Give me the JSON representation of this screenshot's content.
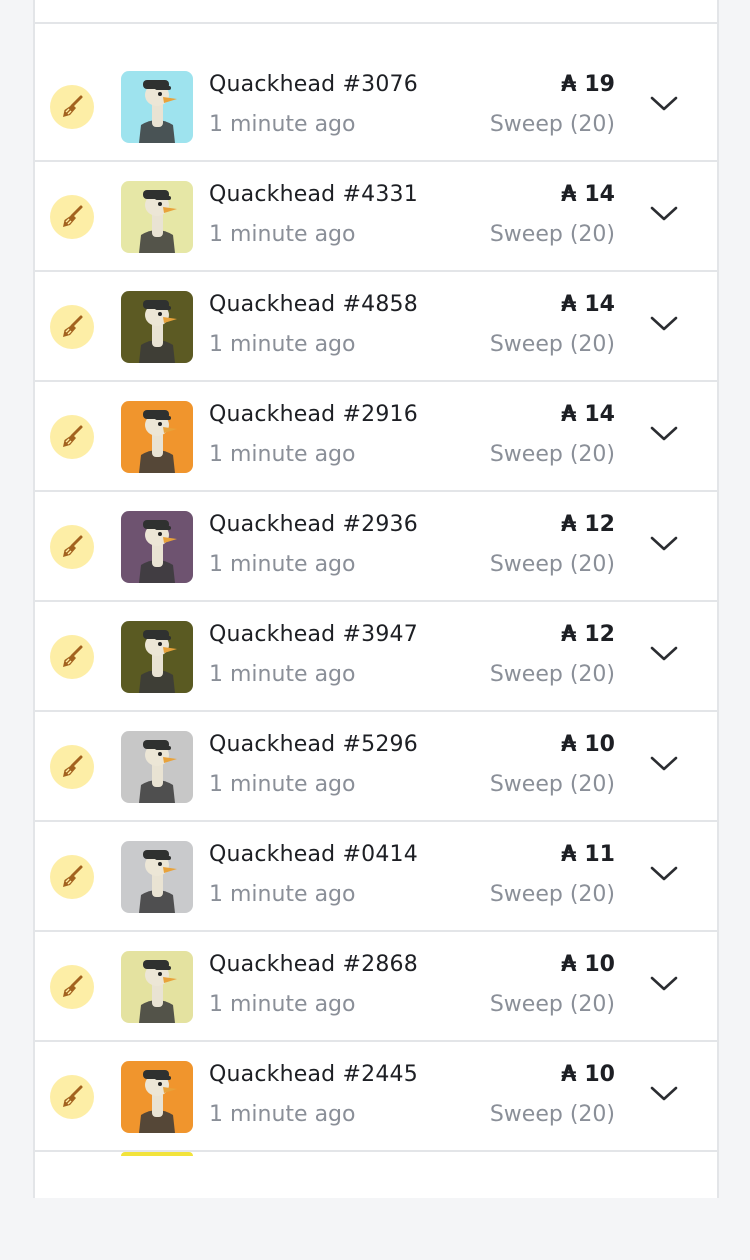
{
  "colors": {
    "badge_bg": "#fdeea6",
    "broom": "#a3621f",
    "text_primary": "#1d1f24",
    "text_secondary": "#8a8f98",
    "divider": "#e3e5e8"
  },
  "icons": {
    "row_badge": "broom-icon",
    "expand": "chevron-down-icon",
    "currency": "ada-currency-icon"
  },
  "items": [
    {
      "name": "Quackhead #3076",
      "time": "1 minute ago",
      "currency": "₳",
      "price": "19",
      "action": "Sweep (20)",
      "thumb_bg": "#9ee3ee"
    },
    {
      "name": "Quackhead #4331",
      "time": "1 minute ago",
      "currency": "₳",
      "price": "14",
      "action": "Sweep (20)",
      "thumb_bg": "#e6e7a6"
    },
    {
      "name": "Quackhead #4858",
      "time": "1 minute ago",
      "currency": "₳",
      "price": "14",
      "action": "Sweep (20)",
      "thumb_bg": "#5c5a23"
    },
    {
      "name": "Quackhead #2916",
      "time": "1 minute ago",
      "currency": "₳",
      "price": "14",
      "action": "Sweep (20)",
      "thumb_bg": "#f0952d"
    },
    {
      "name": "Quackhead #2936",
      "time": "1 minute ago",
      "currency": "₳",
      "price": "12",
      "action": "Sweep (20)",
      "thumb_bg": "#6e5370"
    },
    {
      "name": "Quackhead #3947",
      "time": "1 minute ago",
      "currency": "₳",
      "price": "12",
      "action": "Sweep (20)",
      "thumb_bg": "#5a5a22"
    },
    {
      "name": "Quackhead #5296",
      "time": "1 minute ago",
      "currency": "₳",
      "price": "10",
      "action": "Sweep (20)",
      "thumb_bg": "#c7c7c7"
    },
    {
      "name": "Quackhead #0414",
      "time": "1 minute ago",
      "currency": "₳",
      "price": "11",
      "action": "Sweep (20)",
      "thumb_bg": "#c9cacc"
    },
    {
      "name": "Quackhead #2868",
      "time": "1 minute ago",
      "currency": "₳",
      "price": "10",
      "action": "Sweep (20)",
      "thumb_bg": "#e4e2a0"
    },
    {
      "name": "Quackhead #2445",
      "time": "1 minute ago",
      "currency": "₳",
      "price": "10",
      "action": "Sweep (20)",
      "thumb_bg": "#f0952d"
    }
  ]
}
